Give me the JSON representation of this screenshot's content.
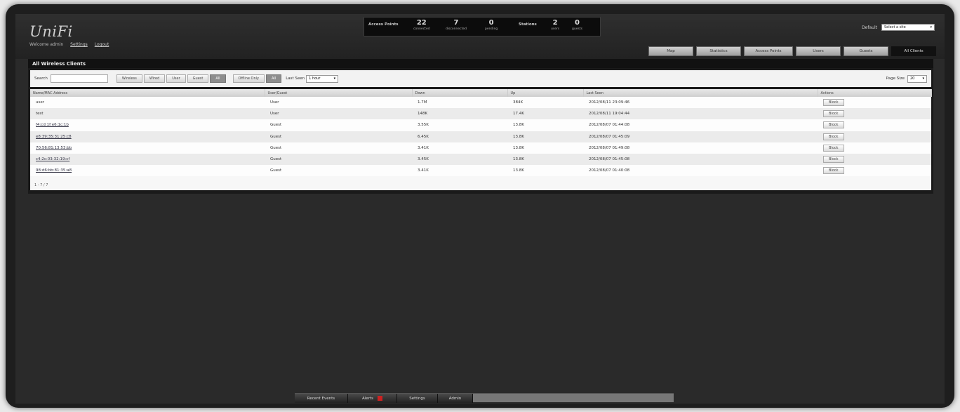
{
  "app": {
    "logo": "UniFi"
  },
  "header": {
    "welcome": "Welcome admin",
    "settings_link": "Settings",
    "logout_link": "Logout",
    "access_points_label": "Access Points",
    "stations_label": "Stations",
    "stats": [
      {
        "value": "22",
        "label": "connected"
      },
      {
        "value": "7",
        "label": "disconnected"
      },
      {
        "value": "0",
        "label": "pending"
      },
      {
        "value": "2",
        "label": "users"
      },
      {
        "value": "0",
        "label": "guests"
      }
    ],
    "site_label": "Default",
    "site_value": "Select a site"
  },
  "top_tabs": [
    "Map",
    "Statistics",
    "Access Points",
    "Users",
    "Guests",
    "All Clients"
  ],
  "panel": {
    "title": "All Wireless Clients",
    "search_label": "Search",
    "search_value": "",
    "filters": [
      {
        "label": "Wireless",
        "active": false
      },
      {
        "label": "Wired",
        "active": false
      },
      {
        "label": "User",
        "active": false
      },
      {
        "label": "Guest",
        "active": false
      },
      {
        "label": "All",
        "active": true
      }
    ],
    "online_filters": [
      {
        "label": "Offline Only",
        "active": false
      },
      {
        "label": "All",
        "active": true
      }
    ],
    "last_seen_label": "Last Seen",
    "last_seen_value": "1 hour",
    "page_size_label": "Page Size",
    "page_size_value": "20",
    "pager": "1 - 7 / 7"
  },
  "table": {
    "columns": [
      "Name/MAC Address",
      "User/Guest",
      "Down",
      "Up",
      "Last Seen",
      "Actions"
    ],
    "rows": [
      {
        "name": "user",
        "type": "User",
        "down": "1.7M",
        "up": "384K",
        "last_seen": "2012/08/11 23:09:46",
        "action": "Block"
      },
      {
        "name": "test",
        "type": "User",
        "down": "148K",
        "up": "17.4K",
        "last_seen": "2012/08/11 19:04:44",
        "action": "Block"
      },
      {
        "name": "f4:cd:1f:e6:1c:1b",
        "type": "Guest",
        "down": "3.55K",
        "up": "13.8K",
        "last_seen": "2012/08/07 01:44:08",
        "action": "Block"
      },
      {
        "name": "e8:39:35:31:25:c8",
        "type": "Guest",
        "down": "6.45K",
        "up": "13.8K",
        "last_seen": "2012/08/07 01:45:09",
        "action": "Block"
      },
      {
        "name": "70:56:81:13:53:bb",
        "type": "Guest",
        "down": "3.41K",
        "up": "13.8K",
        "last_seen": "2012/08/07 01:49:08",
        "action": "Block"
      },
      {
        "name": "c4:2c:03:32:19:cf",
        "type": "Guest",
        "down": "3.45K",
        "up": "13.8K",
        "last_seen": "2012/08/07 01:45:08",
        "action": "Block"
      },
      {
        "name": "98:d6:bb:81:35:a8",
        "type": "Guest",
        "down": "3.41K",
        "up": "13.8K",
        "last_seen": "2012/08/07 01:40:08",
        "action": "Block"
      }
    ]
  },
  "bottom_bar": {
    "tabs": [
      {
        "label": "Recent Events"
      },
      {
        "label": "Alerts"
      },
      {
        "label": "Settings"
      },
      {
        "label": "Admin"
      }
    ]
  }
}
